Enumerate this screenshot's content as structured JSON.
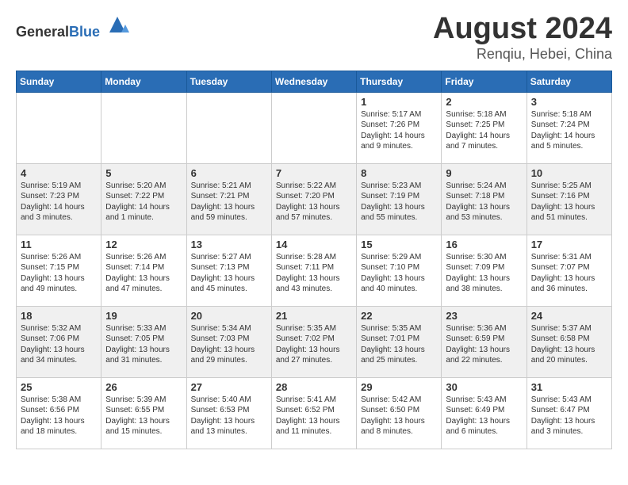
{
  "header": {
    "logo_general": "General",
    "logo_blue": "Blue",
    "month_year": "August 2024",
    "location": "Renqiu, Hebei, China"
  },
  "days_of_week": [
    "Sunday",
    "Monday",
    "Tuesday",
    "Wednesday",
    "Thursday",
    "Friday",
    "Saturday"
  ],
  "weeks": [
    [
      {
        "day": "",
        "info": ""
      },
      {
        "day": "",
        "info": ""
      },
      {
        "day": "",
        "info": ""
      },
      {
        "day": "",
        "info": ""
      },
      {
        "day": "1",
        "info": "Sunrise: 5:17 AM\nSunset: 7:26 PM\nDaylight: 14 hours\nand 9 minutes."
      },
      {
        "day": "2",
        "info": "Sunrise: 5:18 AM\nSunset: 7:25 PM\nDaylight: 14 hours\nand 7 minutes."
      },
      {
        "day": "3",
        "info": "Sunrise: 5:18 AM\nSunset: 7:24 PM\nDaylight: 14 hours\nand 5 minutes."
      }
    ],
    [
      {
        "day": "4",
        "info": "Sunrise: 5:19 AM\nSunset: 7:23 PM\nDaylight: 14 hours\nand 3 minutes."
      },
      {
        "day": "5",
        "info": "Sunrise: 5:20 AM\nSunset: 7:22 PM\nDaylight: 14 hours\nand 1 minute."
      },
      {
        "day": "6",
        "info": "Sunrise: 5:21 AM\nSunset: 7:21 PM\nDaylight: 13 hours\nand 59 minutes."
      },
      {
        "day": "7",
        "info": "Sunrise: 5:22 AM\nSunset: 7:20 PM\nDaylight: 13 hours\nand 57 minutes."
      },
      {
        "day": "8",
        "info": "Sunrise: 5:23 AM\nSunset: 7:19 PM\nDaylight: 13 hours\nand 55 minutes."
      },
      {
        "day": "9",
        "info": "Sunrise: 5:24 AM\nSunset: 7:18 PM\nDaylight: 13 hours\nand 53 minutes."
      },
      {
        "day": "10",
        "info": "Sunrise: 5:25 AM\nSunset: 7:16 PM\nDaylight: 13 hours\nand 51 minutes."
      }
    ],
    [
      {
        "day": "11",
        "info": "Sunrise: 5:26 AM\nSunset: 7:15 PM\nDaylight: 13 hours\nand 49 minutes."
      },
      {
        "day": "12",
        "info": "Sunrise: 5:26 AM\nSunset: 7:14 PM\nDaylight: 13 hours\nand 47 minutes."
      },
      {
        "day": "13",
        "info": "Sunrise: 5:27 AM\nSunset: 7:13 PM\nDaylight: 13 hours\nand 45 minutes."
      },
      {
        "day": "14",
        "info": "Sunrise: 5:28 AM\nSunset: 7:11 PM\nDaylight: 13 hours\nand 43 minutes."
      },
      {
        "day": "15",
        "info": "Sunrise: 5:29 AM\nSunset: 7:10 PM\nDaylight: 13 hours\nand 40 minutes."
      },
      {
        "day": "16",
        "info": "Sunrise: 5:30 AM\nSunset: 7:09 PM\nDaylight: 13 hours\nand 38 minutes."
      },
      {
        "day": "17",
        "info": "Sunrise: 5:31 AM\nSunset: 7:07 PM\nDaylight: 13 hours\nand 36 minutes."
      }
    ],
    [
      {
        "day": "18",
        "info": "Sunrise: 5:32 AM\nSunset: 7:06 PM\nDaylight: 13 hours\nand 34 minutes."
      },
      {
        "day": "19",
        "info": "Sunrise: 5:33 AM\nSunset: 7:05 PM\nDaylight: 13 hours\nand 31 minutes."
      },
      {
        "day": "20",
        "info": "Sunrise: 5:34 AM\nSunset: 7:03 PM\nDaylight: 13 hours\nand 29 minutes."
      },
      {
        "day": "21",
        "info": "Sunrise: 5:35 AM\nSunset: 7:02 PM\nDaylight: 13 hours\nand 27 minutes."
      },
      {
        "day": "22",
        "info": "Sunrise: 5:35 AM\nSunset: 7:01 PM\nDaylight: 13 hours\nand 25 minutes."
      },
      {
        "day": "23",
        "info": "Sunrise: 5:36 AM\nSunset: 6:59 PM\nDaylight: 13 hours\nand 22 minutes."
      },
      {
        "day": "24",
        "info": "Sunrise: 5:37 AM\nSunset: 6:58 PM\nDaylight: 13 hours\nand 20 minutes."
      }
    ],
    [
      {
        "day": "25",
        "info": "Sunrise: 5:38 AM\nSunset: 6:56 PM\nDaylight: 13 hours\nand 18 minutes."
      },
      {
        "day": "26",
        "info": "Sunrise: 5:39 AM\nSunset: 6:55 PM\nDaylight: 13 hours\nand 15 minutes."
      },
      {
        "day": "27",
        "info": "Sunrise: 5:40 AM\nSunset: 6:53 PM\nDaylight: 13 hours\nand 13 minutes."
      },
      {
        "day": "28",
        "info": "Sunrise: 5:41 AM\nSunset: 6:52 PM\nDaylight: 13 hours\nand 11 minutes."
      },
      {
        "day": "29",
        "info": "Sunrise: 5:42 AM\nSunset: 6:50 PM\nDaylight: 13 hours\nand 8 minutes."
      },
      {
        "day": "30",
        "info": "Sunrise: 5:43 AM\nSunset: 6:49 PM\nDaylight: 13 hours\nand 6 minutes."
      },
      {
        "day": "31",
        "info": "Sunrise: 5:43 AM\nSunset: 6:47 PM\nDaylight: 13 hours\nand 3 minutes."
      }
    ]
  ]
}
